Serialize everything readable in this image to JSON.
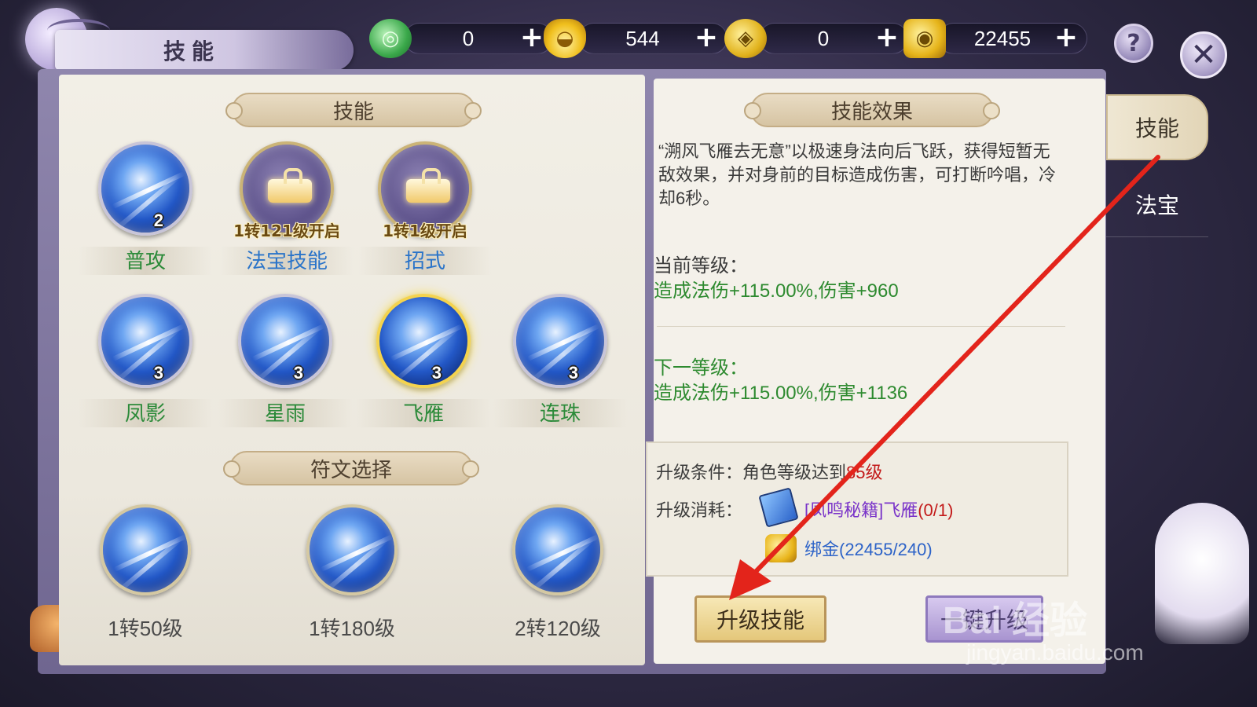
{
  "header": {
    "title": "技能"
  },
  "currencies": [
    {
      "icon": "jade-icon",
      "value": "0"
    },
    {
      "icon": "gold-ingot-icon",
      "value": "544"
    },
    {
      "icon": "coin-icon",
      "value": "0"
    },
    {
      "icon": "bound-gold-icon",
      "value": "22455"
    }
  ],
  "top_buttons": {
    "plus": "+",
    "help": "?",
    "close": "✕"
  },
  "left": {
    "skills_header": "技能",
    "row1": [
      {
        "name": "普攻",
        "level": "2",
        "locked": false,
        "unlock": ""
      },
      {
        "name": "法宝技能",
        "level": "",
        "locked": true,
        "unlock": "1转121级开启"
      },
      {
        "name": "招式",
        "level": "",
        "locked": true,
        "unlock": "1转1级开启"
      }
    ],
    "row2": [
      {
        "name": "凤影",
        "level": "3"
      },
      {
        "name": "星雨",
        "level": "3"
      },
      {
        "name": "飞雁",
        "level": "3",
        "selected": true
      },
      {
        "name": "连珠",
        "level": "3"
      }
    ],
    "rune_header": "符文选择",
    "runes": [
      {
        "label": "1转50级"
      },
      {
        "label": "1转180级"
      },
      {
        "label": "2转120级"
      }
    ]
  },
  "right": {
    "effect_header": "技能效果",
    "description": "“溯风飞雁去无意”以极速身法向后飞跃，获得短暂无敌效果，并对身前的目标造成伤害，可打断吟唱，冷却6秒。",
    "current_level_title": "当前等级：",
    "current_level_effect": "造成法伤+115.00%,伤害+960",
    "next_level_title": "下一等级：",
    "next_level_effect": "造成法伤+115.00%,伤害+1136",
    "condition_label": "升级条件：",
    "condition_text": "角色等级达到",
    "condition_level": "85级",
    "cost_label": "升级消耗：",
    "cost_item": "[凤鸣秘籍]飞雁",
    "cost_item_count": "(0/1)",
    "cost_gold": "绑金(22455/240)",
    "upgrade_button": "升级技能",
    "oneclick_button": "一键升级"
  },
  "tabs": [
    {
      "label": "技能",
      "active": true
    },
    {
      "label": "法宝",
      "active": false
    }
  ],
  "watermark": {
    "brand": "Bai 经验",
    "url": "jingyan.baidu.com"
  },
  "colors": {
    "green": "#2d8a2f",
    "blue": "#2a74c9",
    "red": "#c31a1a",
    "purple": "#7a34c9",
    "arrow": "#e3241b"
  }
}
